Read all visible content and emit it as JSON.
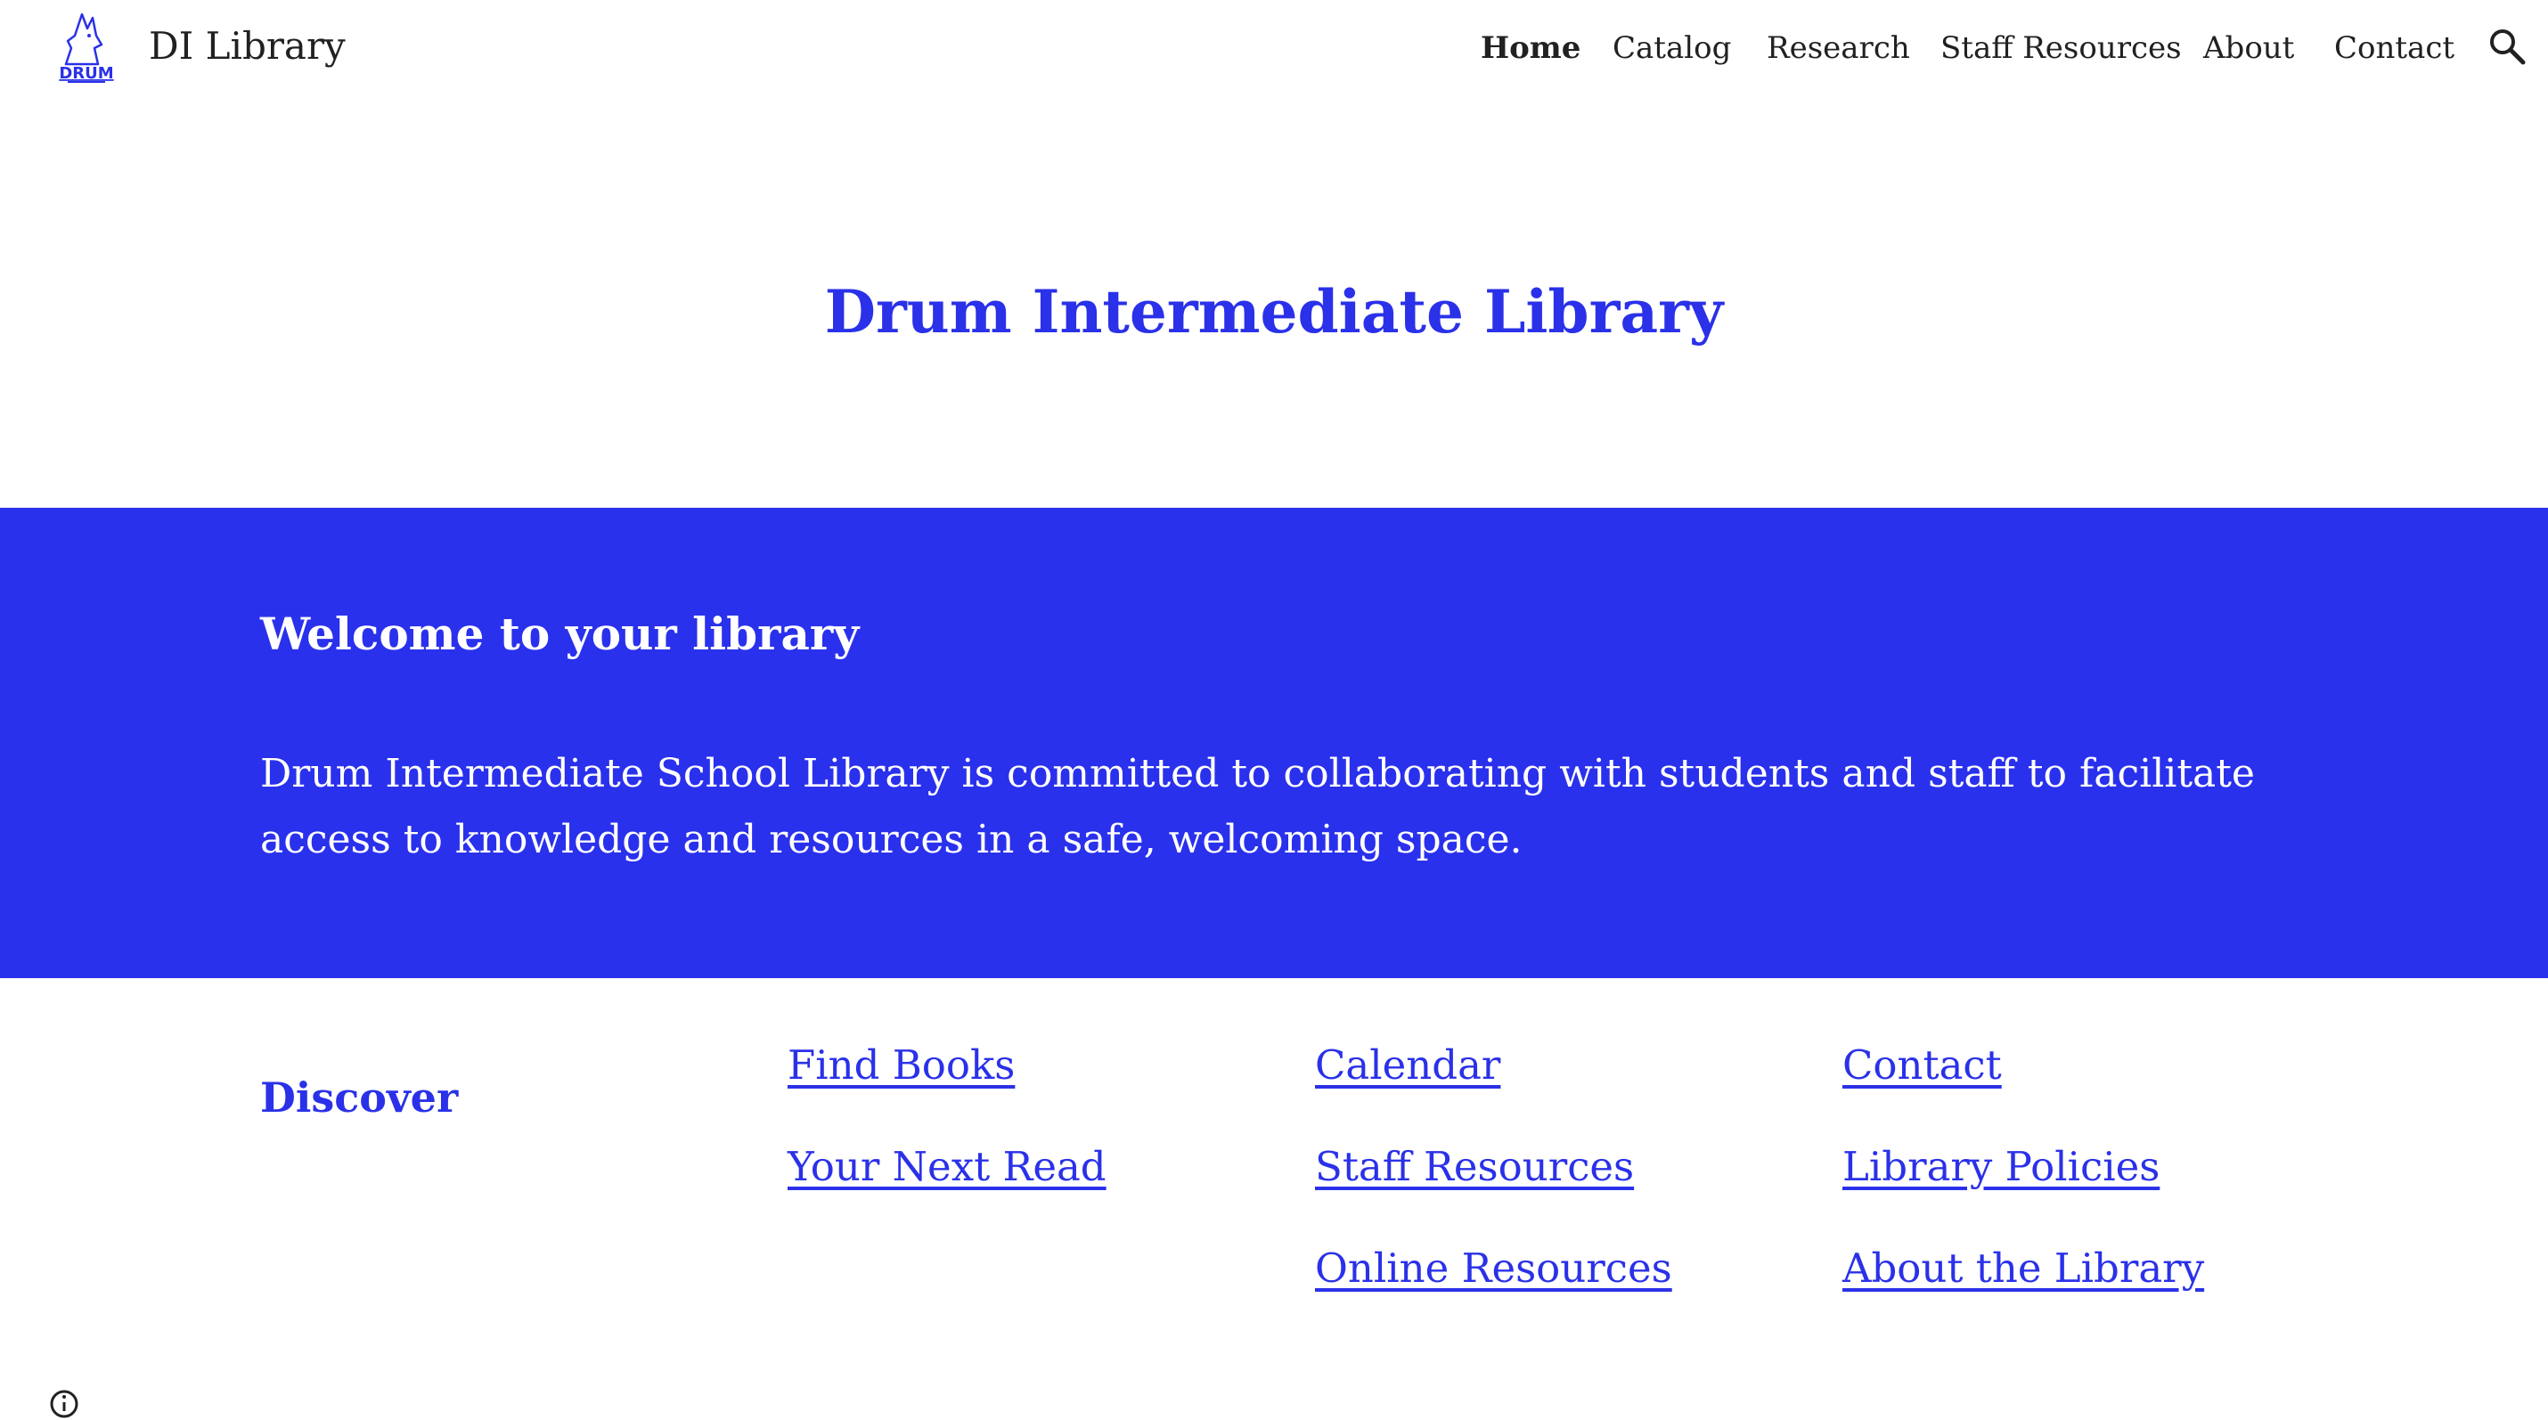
{
  "header": {
    "site_title": "DI Library",
    "logo_text": "DRUM",
    "nav": [
      {
        "label": "Home",
        "active": true
      },
      {
        "label": "Catalog"
      },
      {
        "label": "Research"
      },
      {
        "label": "Staff Resources"
      },
      {
        "label": "About"
      },
      {
        "label": "Contact"
      }
    ],
    "search_icon": "search-icon"
  },
  "main": {
    "title": "Drum Intermediate Library",
    "welcome": {
      "heading": "Welcome to your library",
      "body": "Drum Intermediate School Library is committed to collaborating with students and staff to facilitate access to knowledge and resources in a safe, welcoming space."
    },
    "discover": {
      "heading": "Discover",
      "links": [
        "Find Books",
        "Your Next Read",
        "Calendar",
        "Staff Resources",
        "Online Resources",
        "Contact",
        "Library Policies",
        "About the Library"
      ]
    }
  },
  "colors": {
    "accent": "#2a31e8",
    "band": "#2a31ec",
    "text": "#212121",
    "background": "#ffffff"
  }
}
